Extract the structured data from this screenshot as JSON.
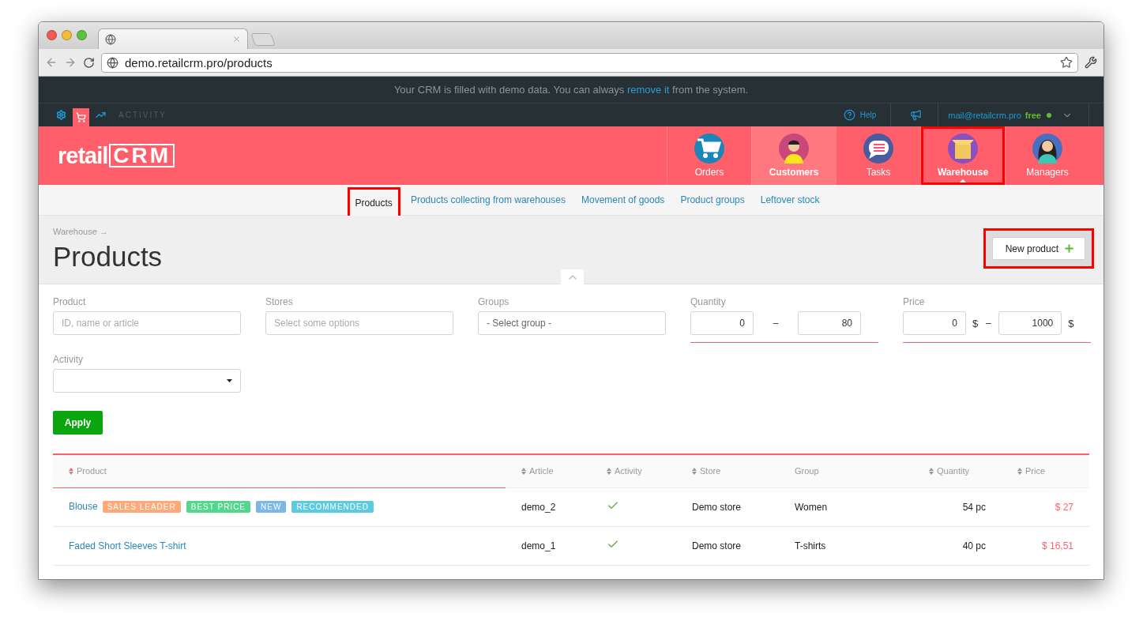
{
  "browser": {
    "url": "demo.retailcrm.pro/products"
  },
  "notice": {
    "text": "Your CRM is filled with demo data. You can always ",
    "link": "remove it",
    "text_end": " from the system."
  },
  "topbar": {
    "tools": [
      {
        "kind": "settings",
        "selected": false
      },
      {
        "kind": "cart",
        "selected": true
      },
      {
        "kind": "chart",
        "selected": false
      }
    ],
    "activity": "ACTIVITY",
    "help": "Help",
    "email": "mail@retailcrm.pro",
    "plan": "free",
    "online": true
  },
  "logo": {
    "text": "retail",
    "mark": "CRM"
  },
  "nav": [
    {
      "kind": "cart",
      "label": "Orders",
      "selected": false,
      "hovered": false,
      "highlighted": false
    },
    {
      "kind": "man",
      "label": "Customers",
      "selected": false,
      "hovered": true,
      "highlighted": false
    },
    {
      "kind": "chat",
      "label": "Tasks",
      "selected": false,
      "hovered": false,
      "highlighted": false
    },
    {
      "kind": "box",
      "label": "Warehouse",
      "selected": true,
      "hovered": false,
      "highlighted": true
    },
    {
      "kind": "woman",
      "label": "Managers",
      "selected": false,
      "hovered": false,
      "highlighted": false
    }
  ],
  "subnav": [
    {
      "label": "Products",
      "selected": true,
      "highlighted": true
    },
    {
      "label": "Products collecting from warehouses",
      "selected": false,
      "highlighted": false
    },
    {
      "label": "Movement of goods",
      "selected": false,
      "highlighted": false
    },
    {
      "label": "Product groups",
      "selected": false,
      "highlighted": false
    },
    {
      "label": "Leftover stock",
      "selected": false,
      "highlighted": false
    }
  ],
  "header": {
    "breadcrumb": "Warehouse →",
    "title": "Products",
    "new_button": {
      "label": "New product",
      "highlighted": true
    }
  },
  "filters": {
    "product": {
      "label": "Product",
      "placeholder": "ID, name or article"
    },
    "stores": {
      "label": "Stores",
      "placeholder": "Select some options"
    },
    "groups": {
      "label": "Groups",
      "value": "- Select group -"
    },
    "quantity": {
      "label": "Quantity",
      "from": "0",
      "separator": "–",
      "to": "80"
    },
    "price": {
      "label": "Price",
      "from": "0",
      "separator": "–",
      "to": "1000",
      "currency": "$"
    },
    "activity": {
      "label": "Activity"
    },
    "apply": "Apply"
  },
  "table": {
    "columns": [
      {
        "label": "Product",
        "sortable": true,
        "sorted": true
      },
      {
        "label": "Article",
        "sortable": true,
        "sorted": false
      },
      {
        "label": "Activity",
        "sortable": true,
        "sorted": false
      },
      {
        "label": "Store",
        "sortable": true,
        "sorted": false
      },
      {
        "label": "Group",
        "sortable": false
      },
      {
        "label": "Quantity",
        "sortable": true,
        "sorted": false
      },
      {
        "label": "Price",
        "sortable": true,
        "sorted": false
      }
    ],
    "rows": [
      {
        "product": "Blouse",
        "tags": [
          {
            "label": "SALES LEADER",
            "color": "#ffa97a"
          },
          {
            "label": "BEST PRICE",
            "color": "#55d68e"
          },
          {
            "label": "NEW",
            "color": "#7ab8e6"
          },
          {
            "label": "RECOMMENDED",
            "color": "#5ccbe0"
          }
        ],
        "article": "demo_2",
        "active": true,
        "store": "Demo store",
        "group": "Women",
        "quantity": "54 pc",
        "price": "$ 27"
      },
      {
        "product": "Faded Short Sleeves T-shirt",
        "tags": [],
        "article": "demo_1",
        "active": true,
        "store": "Demo store",
        "group": "T-shirts",
        "quantity": "40 pc",
        "price": "$ 16,51"
      }
    ]
  }
}
